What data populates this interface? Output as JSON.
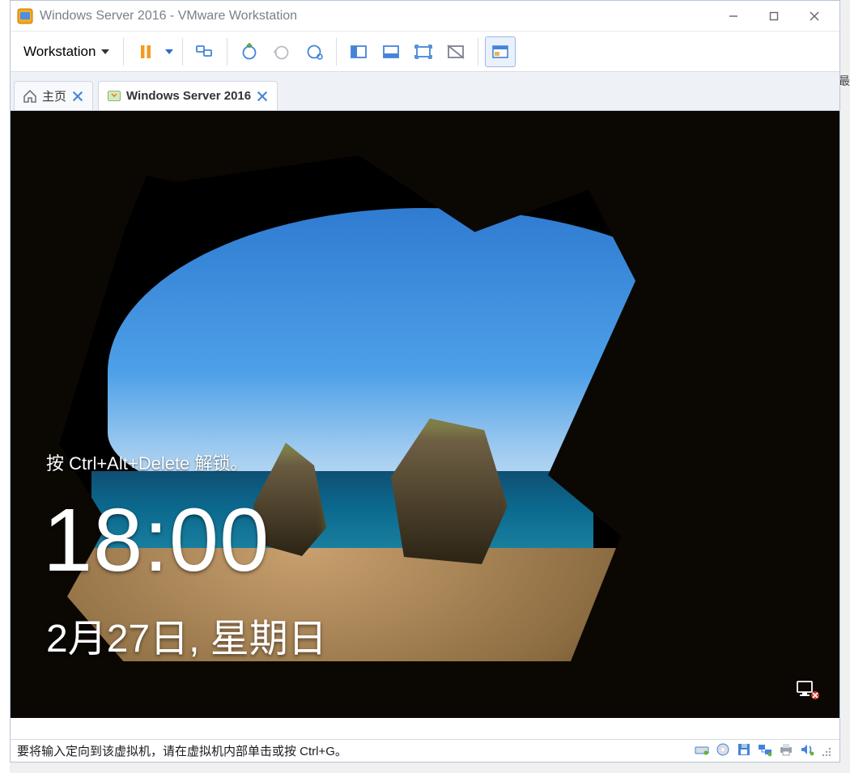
{
  "window": {
    "title": "Windows Server 2016 - VMware Workstation"
  },
  "menu": {
    "workstation": "Workstation"
  },
  "tabs": {
    "home": "主页",
    "vm": "Windows Server 2016"
  },
  "lockscreen": {
    "hint": "按 Ctrl+Alt+Delete 解锁。",
    "time": "18:00",
    "date": "2月27日, 星期日"
  },
  "statusbar": {
    "text": "要将输入定向到该虚拟机，请在虚拟机内部单击或按 Ctrl+G。"
  },
  "outer_cut": "最"
}
